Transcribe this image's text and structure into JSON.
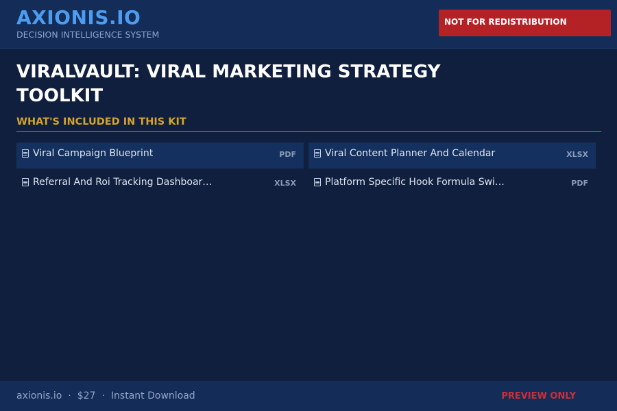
{
  "header": {
    "brand": "AXIONIS.IO",
    "tagline": "DECISION INTELLIGENCE SYSTEM",
    "badge": "NOT FOR REDISTRIBUTION"
  },
  "main": {
    "title": "VIRALVAULT: VIRAL MARKETING STRATEGY TOOLKIT",
    "section_heading": "WHAT'S INCLUDED IN THIS KIT",
    "items": [
      {
        "name": "Viral Campaign Blueprint",
        "type": "PDF",
        "icon": "document-icon"
      },
      {
        "name": "Viral Content Planner And Calendar",
        "type": "XLSX",
        "icon": "document-icon"
      },
      {
        "name": "Referral And Roi Tracking Dashboar…",
        "type": "XLSX",
        "icon": "document-icon"
      },
      {
        "name": "Platform Specific Hook Formula Swi…",
        "type": "PDF",
        "icon": "document-icon"
      }
    ]
  },
  "footer": {
    "site": "axionis.io",
    "separator": "·",
    "price": "$27",
    "delivery": "Instant Download",
    "preview": "PREVIEW ONLY"
  },
  "colors": {
    "background": "#0f1f3d",
    "bar": "#132c58",
    "brand": "#4d9cf0",
    "accent": "#d6a42a",
    "badge": "#b52226",
    "preview": "#c9303a"
  }
}
